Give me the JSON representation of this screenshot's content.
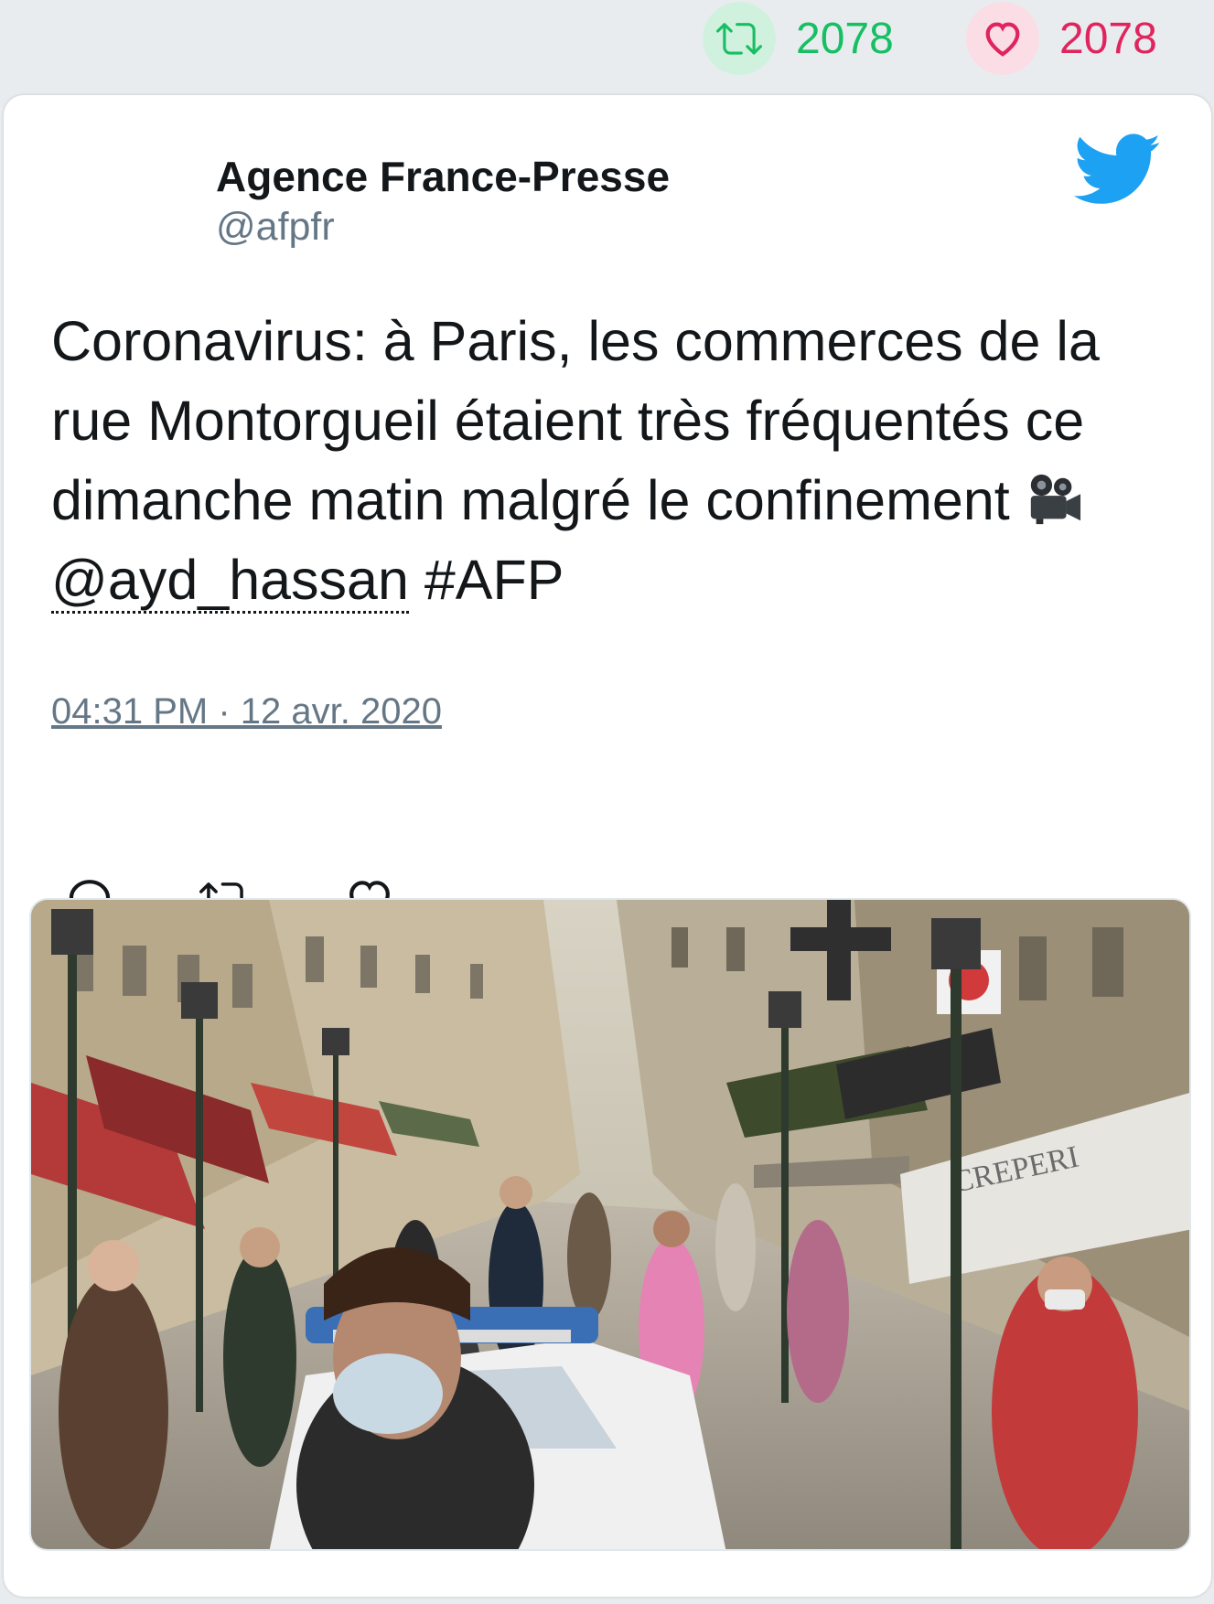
{
  "stats": {
    "retweets": "2078",
    "likes": "2078"
  },
  "author": {
    "name": "Agence France-Presse",
    "handle": "@afpfr"
  },
  "tweet": {
    "text_main": "Coronavirus: à Paris, les commerces de la rue Montorgueil étaient très fréquentés ce dimanche matin malgré le confinement ",
    "mention": "@ayd_hassan",
    "hashtag": " #AFP",
    "timestamp": "04:31 PM · 12 avr. 2020"
  },
  "media": {
    "storefront_sign": "CREPERI"
  },
  "colors": {
    "retweet_green": "#17bf63",
    "like_red": "#e0245e",
    "twitter_blue": "#1da1f2",
    "muted_text": "#657786"
  },
  "icons": {
    "retweet": "retweet-icon",
    "like": "heart-icon",
    "reply": "reply-icon",
    "brand": "twitter-bird-icon",
    "camera": "movie-camera-icon"
  }
}
